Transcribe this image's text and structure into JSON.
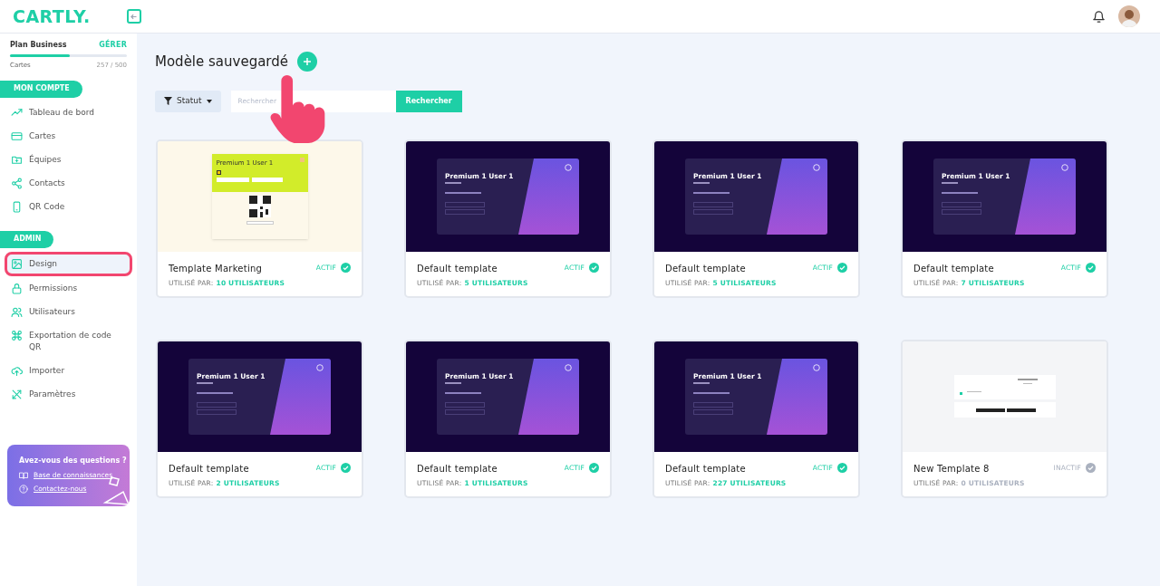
{
  "header": {
    "logo": "CARTLY."
  },
  "plan": {
    "name": "Plan Business",
    "action": "GÉRER",
    "label": "Cartes",
    "count": "257 / 500",
    "level": 0.514
  },
  "sidebar": {
    "sections": [
      {
        "title": "MON COMPTE",
        "items": [
          {
            "label": "Tableau de bord",
            "selected": false
          },
          {
            "label": "Cartes",
            "selected": false
          },
          {
            "label": "Équipes",
            "selected": false
          },
          {
            "label": "Contacts",
            "selected": false
          },
          {
            "label": "QR Code",
            "selected": false
          }
        ]
      },
      {
        "title": "ADMIN",
        "items": [
          {
            "label": "Design",
            "selected": true
          },
          {
            "label": "Permissions",
            "selected": false
          },
          {
            "label": "Utilisateurs",
            "selected": false
          },
          {
            "label": "Exportation de code QR",
            "selected": false
          },
          {
            "label": "Importer",
            "selected": false
          },
          {
            "label": "Paramètres",
            "selected": false
          }
        ]
      }
    ]
  },
  "help": {
    "title": "Avez-vous des questions ?",
    "links": [
      {
        "label": "Base de connaissances"
      },
      {
        "label": "Contactez-nous"
      }
    ]
  },
  "page": {
    "title": "Modèle sauvegardé",
    "filter": "Statut",
    "search_placeholder": "Rechercher",
    "search_button": "Rechercher"
  },
  "templates": [
    {
      "name": "Template Marketing",
      "used_label": "UTILISÉ PAR:",
      "users": "10 UTILISATEURS",
      "status": "ACTIF",
      "active": true,
      "preview": {
        "kind": "lime",
        "title": "Premium 1 User 1"
      }
    },
    {
      "name": "Default template",
      "used_label": "UTILISÉ PAR:",
      "users": "5 UTILISATEURS",
      "status": "ACTIF",
      "active": true,
      "preview": {
        "kind": "dark",
        "title": "Premium 1 User 1"
      }
    },
    {
      "name": "Default template",
      "used_label": "UTILISÉ PAR:",
      "users": "5 UTILISATEURS",
      "status": "ACTIF",
      "active": true,
      "preview": {
        "kind": "dark",
        "title": "Premium 1 User 1"
      }
    },
    {
      "name": "Default template",
      "used_label": "UTILISÉ PAR:",
      "users": "7 UTILISATEURS",
      "status": "ACTIF",
      "active": true,
      "preview": {
        "kind": "dark",
        "title": "Premium 1 User 1"
      }
    },
    {
      "name": "Default template",
      "used_label": "UTILISÉ PAR:",
      "users": "2 UTILISATEURS",
      "status": "ACTIF",
      "active": true,
      "preview": {
        "kind": "dark",
        "title": "Premium 1 User 1"
      }
    },
    {
      "name": "Default template",
      "used_label": "UTILISÉ PAR:",
      "users": "1 UTILISATEURS",
      "status": "ACTIF",
      "active": true,
      "preview": {
        "kind": "dark",
        "title": "Premium 1 User 1"
      }
    },
    {
      "name": "Default template",
      "used_label": "UTILISÉ PAR:",
      "users": "227 UTILISATEURS",
      "status": "ACTIF",
      "active": true,
      "preview": {
        "kind": "dark",
        "title": "Premium 1 User 1"
      }
    },
    {
      "name": "New Template 8",
      "used_label": "UTILISÉ PAR:",
      "users": "0 UTILISATEURS",
      "status": "INACTIF",
      "active": false,
      "preview": {
        "kind": "blank"
      }
    }
  ]
}
